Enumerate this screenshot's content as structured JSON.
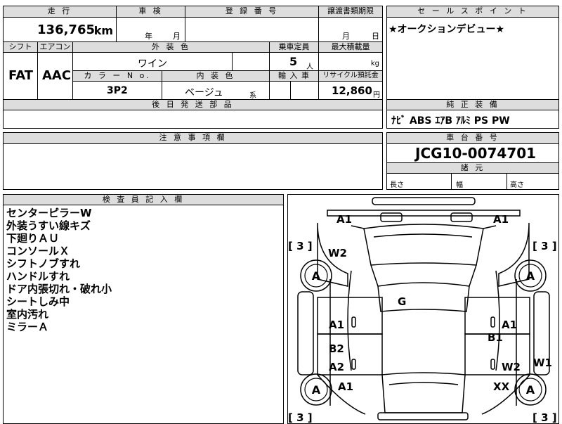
{
  "top_left": {
    "mileage_label": "走 行",
    "mileage_value": "136,765",
    "mileage_unit": "km",
    "inspection_label": "車 検",
    "inspection_year": "年",
    "inspection_month": "月",
    "registration_label": "登 録 番 号",
    "transfer_label": "譲渡書類期限",
    "transfer_month": "月",
    "transfer_day": "日",
    "shift_label": "シフト",
    "ac_label": "エアコン",
    "exterior_color_label": "外 装 色",
    "capacity_label": "乗車定員",
    "max_load_label": "最大積載量",
    "shift_value": "FAT",
    "ac_value": "AAC",
    "exterior_color_value": "ワイン",
    "capacity_value": "5",
    "capacity_unit": "人",
    "load_unit": "kg",
    "color_no_label": "カ ラ ー N o.",
    "interior_color_label": "内 装 色",
    "import_label": "輸 入 車",
    "recycle_label": "リサイクル預託金",
    "color_no_value": "3P2",
    "interior_color_value": "ベージュ",
    "interior_color_suffix": "系",
    "recycle_value": "12,860",
    "recycle_unit": "円",
    "later_parts_label": "後 日 発 送 部 品"
  },
  "sales_point": {
    "label": "セ ー ル ス ポ イ ン ト",
    "text": "★オークションデビュー★"
  },
  "equipment": {
    "label": "純 正 装 備",
    "text": "ﾅﾋﾞ  ABS  ｴｱB  ｱﾙﾐ  PS  PW"
  },
  "notes": {
    "label": "注 意 事 項 欄"
  },
  "chassis": {
    "label": "車 台 番 号",
    "value": "JCG10-0074701",
    "dims_label": "諸 元",
    "length_label": "長さ",
    "width_label": "幅",
    "height_label": "高さ"
  },
  "inspector": {
    "label": "検 査 員 記 入 欄",
    "lines": [
      "センターピラーW",
      "外装うすい線キズ",
      "下廻りＡＵ",
      "コンソールＸ",
      "シフトノブすれ",
      "ハンドルすれ",
      "ドア内張切れ・破れ小",
      "シートしみ中",
      "室内汚れ",
      "ミラーＡ"
    ]
  },
  "diagram": {
    "tire_bracket": "[ 3 ]",
    "tire_label": "A",
    "marks": {
      "a1_top_left": "A1",
      "a1_top_right": "A1",
      "w2_left": "W2",
      "g_center": "G",
      "a1_mid_left": "A1",
      "a1_mid_right": "A1",
      "b1_right": "B1",
      "b2_left": "B2",
      "a2_left": "A2",
      "w2_right": "W2",
      "w1_right": "W1",
      "a1_low_left": "A1",
      "xx_right": "XX"
    }
  }
}
